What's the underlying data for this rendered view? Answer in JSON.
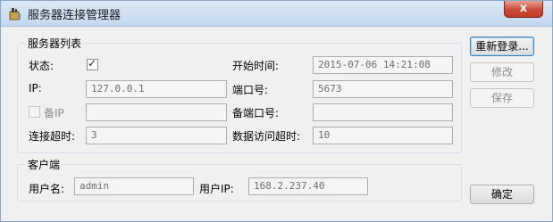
{
  "window": {
    "title": "服务器连接管理器",
    "close_glyph": "x"
  },
  "server_group": {
    "title": "服务器列表",
    "status_label": "状态:",
    "status_checked": true,
    "start_time_label": "开始时间:",
    "start_time_value": "2015-07-06 14:21:08",
    "ip_label": "IP:",
    "ip_value": "127.0.0.1",
    "port_label": "端口号:",
    "port_value": "5673",
    "backup_ip_label": "备IP",
    "backup_ip_value": "",
    "backup_port_label": "备端口号:",
    "backup_port_value": "",
    "timeout_label": "连接超时:",
    "timeout_value": "3",
    "data_timeout_label": "数据访问超时:",
    "data_timeout_value": "10"
  },
  "client_group": {
    "title": "客户端",
    "username_label": "用户名:",
    "username_value": "admin",
    "user_ip_label": "用户IP:",
    "user_ip_value": "168.2.237.40"
  },
  "buttons": {
    "relogin": "重新登录...",
    "modify": "修改",
    "save": "保存",
    "ok": "确定"
  }
}
